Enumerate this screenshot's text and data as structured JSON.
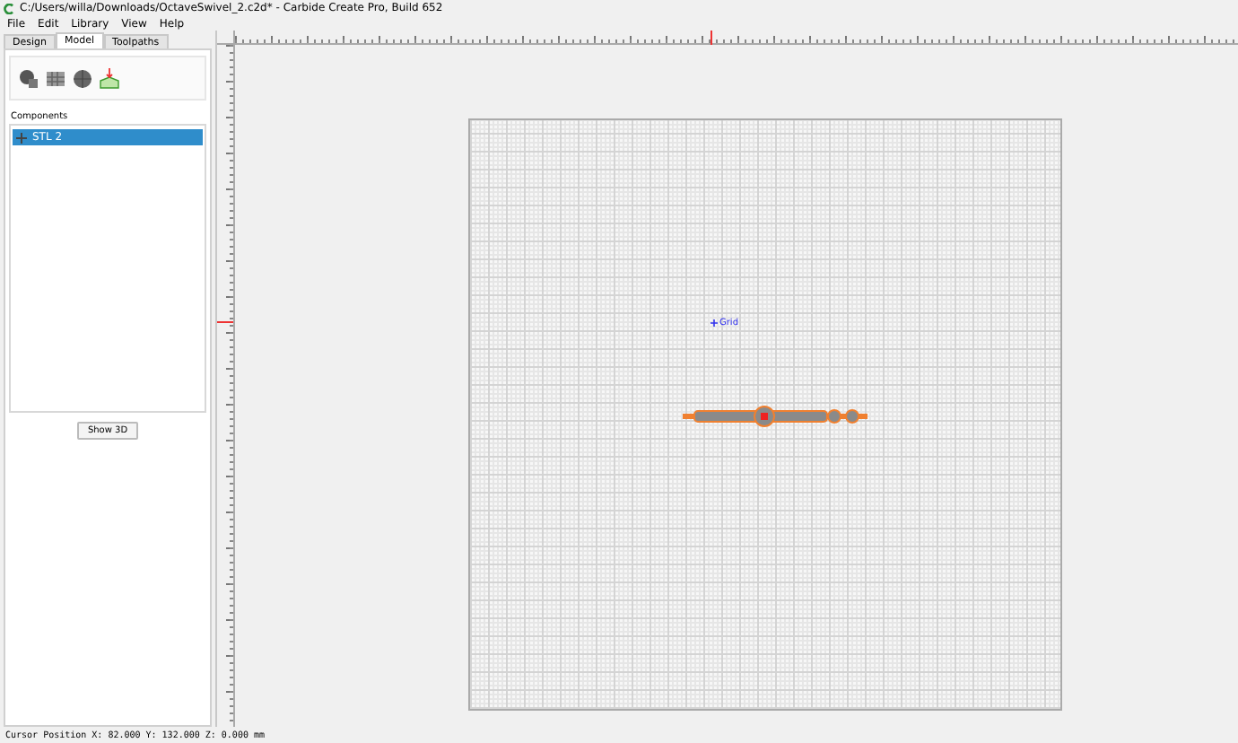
{
  "window": {
    "title": "C:/Users/willa/Downloads/OctaveSwivel_2.c2d* - Carbide Create Pro, Build 652"
  },
  "menu": [
    "File",
    "Edit",
    "Library",
    "View",
    "Help"
  ],
  "tabs": [
    {
      "label": "Design",
      "selected": false
    },
    {
      "label": "Model",
      "selected": true
    },
    {
      "label": "Toolpaths",
      "selected": false
    }
  ],
  "components": {
    "heading": "Components",
    "items": [
      {
        "label": "STL 2",
        "selected": true
      }
    ]
  },
  "show_3d_button": "Show 3D",
  "canvas": {
    "grid_label": "Grid"
  },
  "status_bar": "Cursor Position X: 82.000 Y: 132.000 Z: 0.000 mm"
}
